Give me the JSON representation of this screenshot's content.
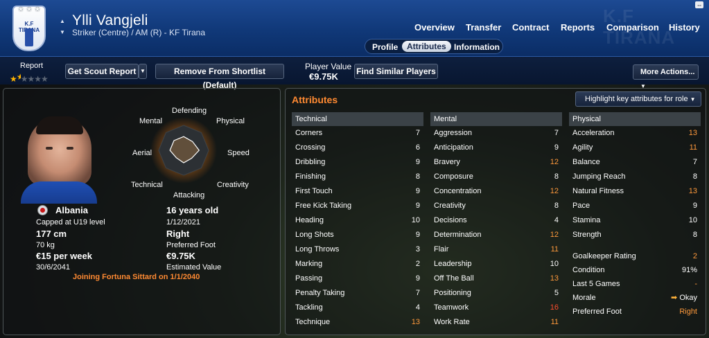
{
  "player": {
    "name": "Ylli Vangjeli",
    "subtitle": "Striker (Centre) / AM (R) - KF Tirana",
    "club_crest_text": "K.F TIRANA"
  },
  "nav": {
    "tabs": [
      "Overview",
      "Transfer",
      "Contract",
      "Reports",
      "Comparison",
      "History"
    ],
    "subtabs": [
      "Profile",
      "Attributes",
      "Information"
    ],
    "selected_subtab": "Attributes"
  },
  "toolbar": {
    "report_label": "Report",
    "scout_button": "Get Scout Report",
    "shortlist_button": "Remove From Shortlist (Default)",
    "value_label": "Player Value",
    "value": "€9.75K",
    "similar_button": "Find Similar Players",
    "more_actions": "More Actions..."
  },
  "report": {
    "stars": 1.5,
    "max_stars": 5
  },
  "radar": {
    "labels": [
      "Defending",
      "Physical",
      "Speed",
      "Creativity",
      "Attacking",
      "Technical",
      "Aerial",
      "Mental"
    ],
    "values": [
      0.55,
      0.5,
      0.62,
      0.45,
      0.5,
      0.42,
      0.55,
      0.55
    ]
  },
  "info": {
    "nationality": "Albania",
    "caps": "Capped at U19 level",
    "height": "177 cm",
    "weight": "70 kg",
    "wage": "€15 per week",
    "contract_end": "30/6/2041",
    "age": "16 years old",
    "dob": "1/12/2021",
    "foot": "Right",
    "foot_label": "Preferred Foot",
    "value": "€9.75K",
    "value_label": "Estimated Value",
    "transfer_note": "Joining Fortuna Sittard on 1/1/2040"
  },
  "attributes": {
    "title": "Attributes",
    "highlight_button": "Highlight key attributes for role",
    "technical": {
      "header": "Technical",
      "rows": [
        [
          "Corners",
          "7"
        ],
        [
          "Crossing",
          "6"
        ],
        [
          "Dribbling",
          "9"
        ],
        [
          "Finishing",
          "8"
        ],
        [
          "First Touch",
          "9"
        ],
        [
          "Free Kick Taking",
          "9"
        ],
        [
          "Heading",
          "10"
        ],
        [
          "Long Shots",
          "9"
        ],
        [
          "Long Throws",
          "3"
        ],
        [
          "Marking",
          "2"
        ],
        [
          "Passing",
          "9"
        ],
        [
          "Penalty Taking",
          "7"
        ],
        [
          "Tackling",
          "4"
        ],
        [
          "Technique",
          "13"
        ]
      ]
    },
    "mental": {
      "header": "Mental",
      "rows": [
        [
          "Aggression",
          "7"
        ],
        [
          "Anticipation",
          "9"
        ],
        [
          "Bravery",
          "12"
        ],
        [
          "Composure",
          "8"
        ],
        [
          "Concentration",
          "12"
        ],
        [
          "Creativity",
          "8"
        ],
        [
          "Decisions",
          "4"
        ],
        [
          "Determination",
          "12"
        ],
        [
          "Flair",
          "11"
        ],
        [
          "Leadership",
          "10"
        ],
        [
          "Off The Ball",
          "13"
        ],
        [
          "Positioning",
          "5"
        ],
        [
          "Teamwork",
          "16"
        ],
        [
          "Work Rate",
          "11"
        ]
      ]
    },
    "physical": {
      "header": "Physical",
      "rows": [
        [
          "Acceleration",
          "13"
        ],
        [
          "Agility",
          "11"
        ],
        [
          "Balance",
          "7"
        ],
        [
          "Jumping Reach",
          "8"
        ],
        [
          "Natural Fitness",
          "13"
        ],
        [
          "Pace",
          "9"
        ],
        [
          "Stamina",
          "10"
        ],
        [
          "Strength",
          "8"
        ]
      ]
    },
    "extra": [
      [
        "Goalkeeper Rating",
        "2"
      ],
      [
        "Condition",
        "91%"
      ],
      [
        "Last 5 Games",
        "-"
      ],
      [
        "Morale",
        "Okay"
      ],
      [
        "Preferred Foot",
        "Right"
      ]
    ]
  },
  "colors": {
    "accent": "#ff8a32",
    "high": "#ff9a3c",
    "very_high": "#ff4d2e"
  }
}
